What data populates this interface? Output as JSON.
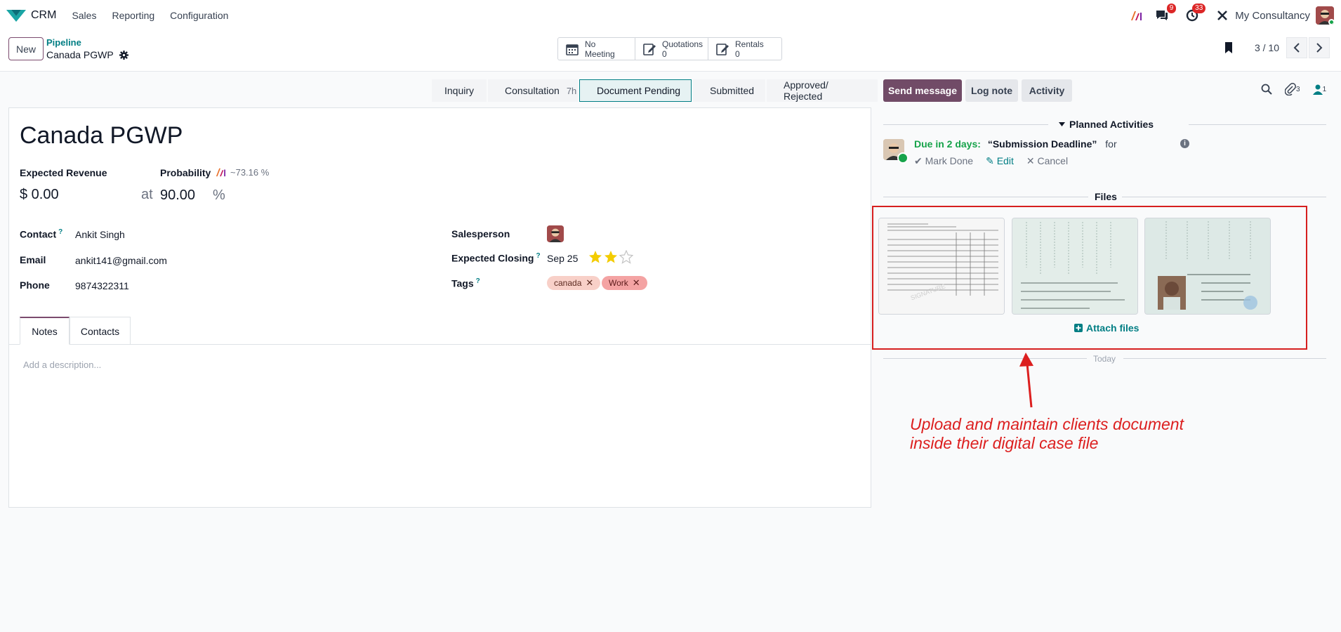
{
  "navbar": {
    "app_name": "CRM",
    "menu": [
      "Sales",
      "Reporting",
      "Configuration"
    ],
    "messages_badge": "9",
    "activities_badge": "33",
    "company": "My Consultancy"
  },
  "control": {
    "new_label": "New",
    "breadcrumb_parent": "Pipeline",
    "breadcrumb_current": "Canada PGWP",
    "smart_buttons": {
      "meeting": "No Meeting",
      "quotations_label": "Quotations",
      "quotations_count": "0",
      "rentals_label": "Rentals",
      "rentals_count": "0"
    },
    "pager": "3 / 10"
  },
  "stages": [
    {
      "label": "Inquiry"
    },
    {
      "label": "Consultation",
      "duration": "7h"
    },
    {
      "label": "Document Pending"
    },
    {
      "label": "Submitted"
    },
    {
      "label": "Approved/ Rejected"
    }
  ],
  "form": {
    "title": "Canada PGWP",
    "expected_revenue_label": "Expected Revenue",
    "expected_revenue": "$ 0.00",
    "at_label": "at",
    "probability_label": "Probability",
    "probability_ai": "~73.16 %",
    "probability": "90.00",
    "percent_sign": "%",
    "contact_label": "Contact",
    "contact": "Ankit Singh",
    "email_label": "Email",
    "email": "ankit141@gmail.com",
    "phone_label": "Phone",
    "phone": "9874322311",
    "salesperson_label": "Salesperson",
    "expected_closing_label": "Expected Closing",
    "expected_closing": "Sep 25",
    "priority_stars": 2,
    "tags_label": "Tags",
    "tags": [
      "canada",
      "Work"
    ],
    "tabs": [
      "Notes",
      "Contacts"
    ],
    "description_placeholder": "Add a description..."
  },
  "chatter": {
    "send_message": "Send message",
    "log_note": "Log note",
    "activity": "Activity",
    "attachments_count": "3",
    "followers_count": "1",
    "planned_activities": "Planned Activities",
    "due_text": "Due in 2 days:",
    "activity_name": "“Submission Deadline”",
    "for_text": "for",
    "mark_done": "Mark Done",
    "edit": "Edit",
    "cancel": "Cancel",
    "files_title": "Files",
    "attach_files": "Attach files",
    "today": "Today"
  },
  "annotation": {
    "line1": "Upload and maintain clients document",
    "line2": "inside their digital case file",
    "color": "#dc1f1f"
  },
  "colors": {
    "brand": "#714b67",
    "accent_teal": "#017e84",
    "badge_red": "#dc2626"
  }
}
